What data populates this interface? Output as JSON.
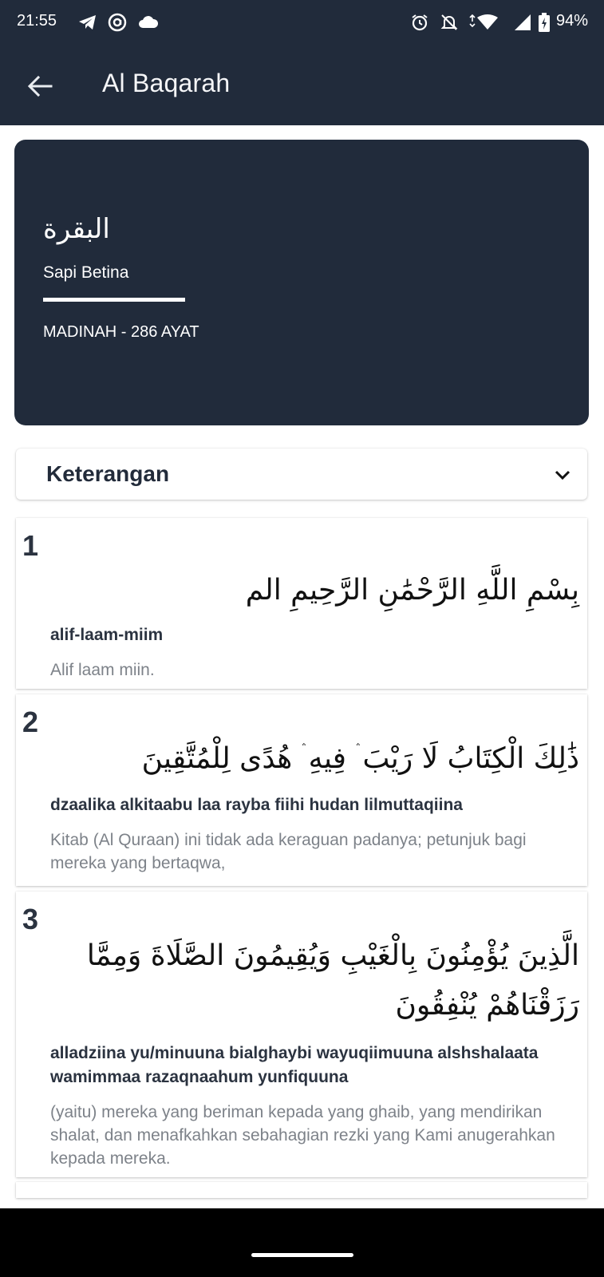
{
  "status_bar": {
    "time": "21:55",
    "battery": "94%",
    "icons": [
      "telegram-icon",
      "at-sign-icon",
      "cloud-icon",
      "alarm-icon",
      "mute-icon",
      "wifi-icon",
      "signal-icon",
      "battery-icon"
    ]
  },
  "app_bar": {
    "title": "Al Baqarah",
    "back_icon": "arrow-left-icon"
  },
  "surah": {
    "arabic_name": "البقرة",
    "meaning": "Sapi Betina",
    "info": "MADINAH - 286 AYAT"
  },
  "keterangan": {
    "label": "Keterangan",
    "icon": "chevron-down-icon"
  },
  "ayahs": [
    {
      "number": "1",
      "arabic": "بِسْمِ اللَّهِ الرَّحْمَٰنِ الرَّحِيمِ الم",
      "latin": "alif-laam-miim",
      "translation": "Alif laam miin."
    },
    {
      "number": "2",
      "arabic": "ذَٰلِكَ الْكِتَابُ لَا رَيْبَ ۛ فِيهِ ۛ هُدًى لِلْمُتَّقِينَ",
      "latin": "dzaalika alkitaabu laa rayba fiihi hudan lilmuttaqiina",
      "translation": "Kitab (Al Quraan) ini tidak ada keraguan padanya; petunjuk bagi mereka yang bertaqwa,"
    },
    {
      "number": "3",
      "arabic": "الَّذِينَ يُؤْمِنُونَ بِالْغَيْبِ وَيُقِيمُونَ الصَّلَاةَ وَمِمَّا رَزَقْنَاهُمْ يُنْفِقُونَ",
      "latin": "alladziina yu/minuuna bialghaybi wayuqiimuuna alshshalaata wamimmaa razaqnaahum yunfiquuna",
      "translation": "(yaitu) mereka yang beriman kepada yang ghaib, yang mendirikan shalat, dan menafkahkan sebahagian rezki yang Kami anugerahkan kepada mereka."
    }
  ],
  "colors": {
    "primary_dark": "#212b3b",
    "text_dark": "#2b3340",
    "text_muted": "#7d8289"
  }
}
